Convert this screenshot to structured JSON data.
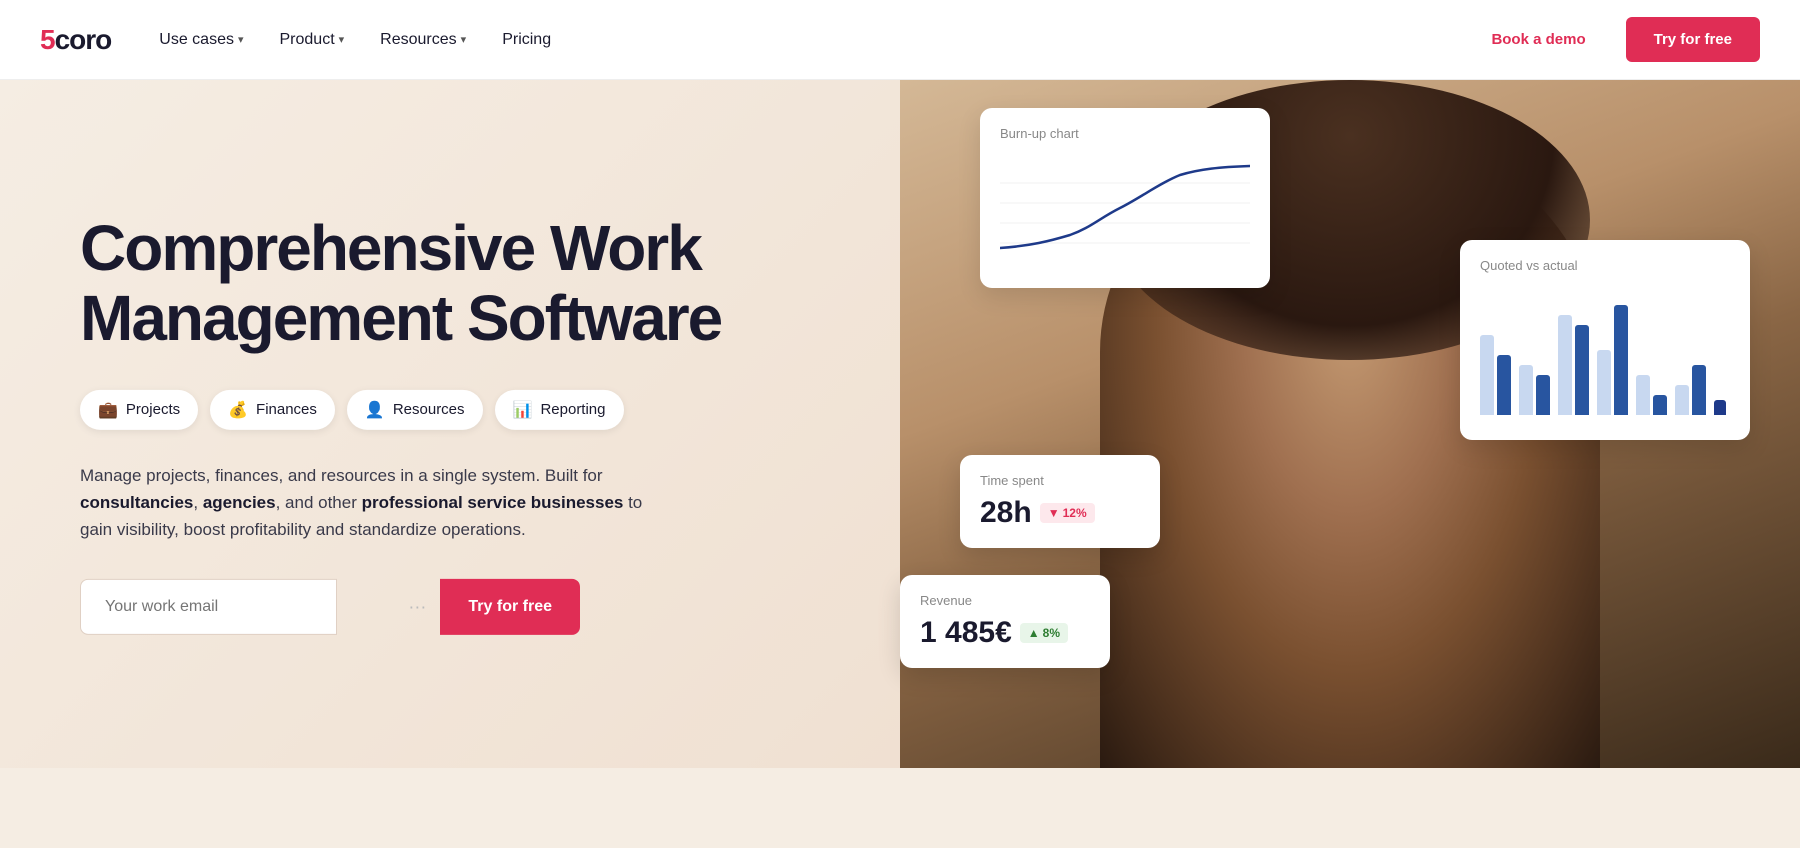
{
  "navbar": {
    "logo": "5coro",
    "nav_items": [
      {
        "label": "Use cases",
        "has_dropdown": true
      },
      {
        "label": "Product",
        "has_dropdown": true
      },
      {
        "label": "Resources",
        "has_dropdown": true
      },
      {
        "label": "Pricing",
        "has_dropdown": false
      }
    ],
    "book_demo": "Book a demo",
    "try_free": "Try for free"
  },
  "hero": {
    "title": "Comprehensive Work Management Software",
    "pills": [
      {
        "label": "Projects",
        "icon": "💼"
      },
      {
        "label": "Finances",
        "icon": "💰"
      },
      {
        "label": "Resources",
        "icon": "👤"
      },
      {
        "label": "Reporting",
        "icon": "📊"
      }
    ],
    "description_1": "Manage projects, finances, and resources in a single system. Built for ",
    "bold_1": "consultancies",
    "description_2": ", ",
    "bold_2": "agencies",
    "description_3": ", and other ",
    "bold_3": "professional service businesses",
    "description_4": " to gain visibility, boost profitability and standardize operations.",
    "email_placeholder": "Your work email",
    "try_btn": "Try for free"
  },
  "cards": {
    "burnup": {
      "title": "Burn-up chart"
    },
    "quoted": {
      "title": "Quoted vs actual"
    },
    "time_spent": {
      "label": "Time spent",
      "value": "28h",
      "badge": "▼ 12%"
    },
    "revenue": {
      "label": "Revenue",
      "value": "1 485€",
      "badge": "▲ 8%"
    }
  }
}
